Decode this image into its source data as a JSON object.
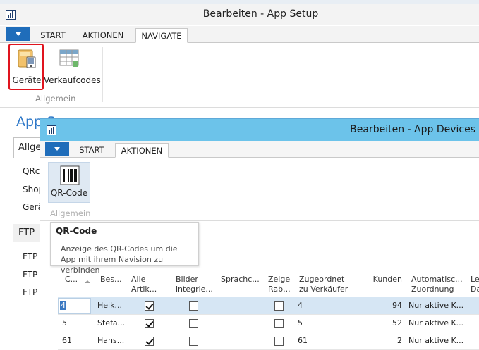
{
  "outer": {
    "title": "Bearbeiten - App Setup",
    "tabs": [
      "START",
      "AKTIONEN",
      "NAVIGATE"
    ],
    "ribbon": {
      "buttons": [
        {
          "label": "Geräte",
          "icon": "devices-icon"
        },
        {
          "label": "Verkaufcodes",
          "icon": "table-grid-icon"
        }
      ],
      "group_label": "Allgemein"
    },
    "page_title": "App S",
    "fasttab": "Allge",
    "fields": [
      "QRc",
      "Shop",
      "Gerä"
    ],
    "ftp_tab": "FTP",
    "ftp_fields": [
      "FTP",
      "FTP",
      "FTP"
    ]
  },
  "dialog": {
    "title": "Bearbeiten - App Devices",
    "tabs": [
      "START",
      "AKTIONEN"
    ],
    "ribbon": {
      "button": {
        "label": "QR-Code",
        "icon": "barcode-icon"
      },
      "group_label": "Allgemein"
    },
    "tooltip": {
      "title": "QR-Code",
      "body": "Anzeige des QR-Codes um die App mit ihrem Navision zu verbinden"
    },
    "columns": [
      {
        "l1": "C...",
        "l2": ""
      },
      {
        "l1": "Bes...",
        "l2": ""
      },
      {
        "l1": "Alle",
        "l2": "Artik..."
      },
      {
        "l1": "Bilder",
        "l2": "integrie..."
      },
      {
        "l1": "Sprachc...",
        "l2": ""
      },
      {
        "l1": "Zeige",
        "l2": "Rab..."
      },
      {
        "l1": "Zugeordnet",
        "l2": "zu Verkäufer"
      },
      {
        "l1": "Kunden",
        "l2": ""
      },
      {
        "l1": "Automatisc...",
        "l2": "Zuordnung"
      },
      {
        "l1": "Le",
        "l2": "Da"
      }
    ],
    "rows": [
      {
        "code": "4",
        "name": "Heik...",
        "alle": true,
        "bilder": false,
        "zeige": false,
        "verkaeufer": "4",
        "kunden": "94",
        "auto": "Nur aktive K..."
      },
      {
        "code": "5",
        "name": "Stefa...",
        "alle": true,
        "bilder": false,
        "zeige": false,
        "verkaeufer": "5",
        "kunden": "52",
        "auto": "Nur aktive K..."
      },
      {
        "code": "61",
        "name": "Hans...",
        "alle": true,
        "bilder": false,
        "zeige": false,
        "verkaeufer": "61",
        "kunden": "2",
        "auto": "Nur aktive K..."
      }
    ]
  },
  "colors": {
    "accent": "#2e78c8",
    "dialog_title_bg": "#6cc3ea",
    "menu_button": "#1f6dba",
    "highlight": "#e0141e",
    "selected_row": "#d6e6f4"
  }
}
